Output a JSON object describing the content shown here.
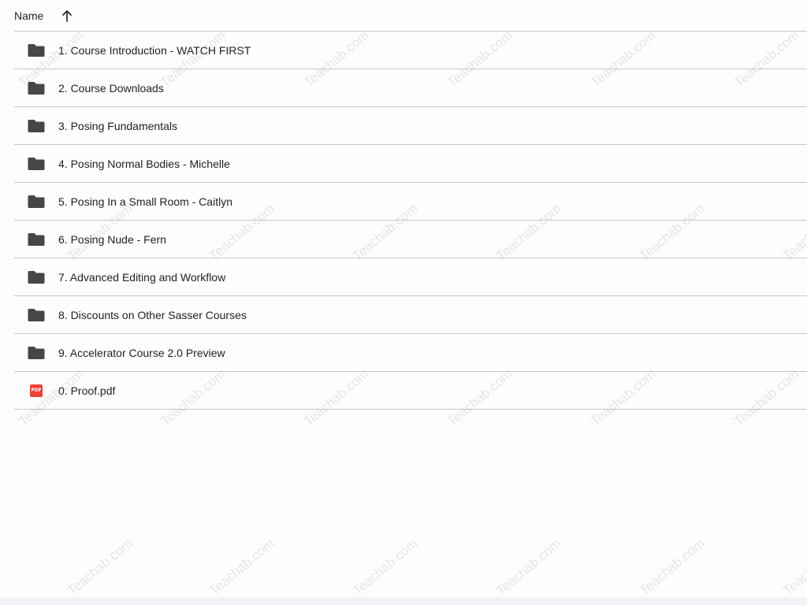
{
  "header": {
    "name_label": "Name",
    "sort_icon": "arrow-up-icon"
  },
  "files": [
    {
      "name": "1. Course Introduction - WATCH FIRST",
      "type": "folder"
    },
    {
      "name": "2. Course Downloads",
      "type": "folder"
    },
    {
      "name": "3. Posing Fundamentals",
      "type": "folder"
    },
    {
      "name": "4. Posing Normal Bodies - Michelle",
      "type": "folder"
    },
    {
      "name": "5. Posing In a Small Room - Caitlyn",
      "type": "folder"
    },
    {
      "name": "6. Posing Nude - Fern",
      "type": "folder"
    },
    {
      "name": "7. Advanced Editing and Workflow",
      "type": "folder"
    },
    {
      "name": "8. Discounts on Other Sasser Courses",
      "type": "folder"
    },
    {
      "name": "9. Accelerator Course 2.0 Preview",
      "type": "folder"
    },
    {
      "name": "0. Proof.pdf",
      "type": "pdf"
    }
  ],
  "pdf_badge": "PDF",
  "watermark": "Teachab.com",
  "colors": {
    "folder": "#444746",
    "pdf": "#ea4335",
    "divider": "#c7c7c7"
  }
}
